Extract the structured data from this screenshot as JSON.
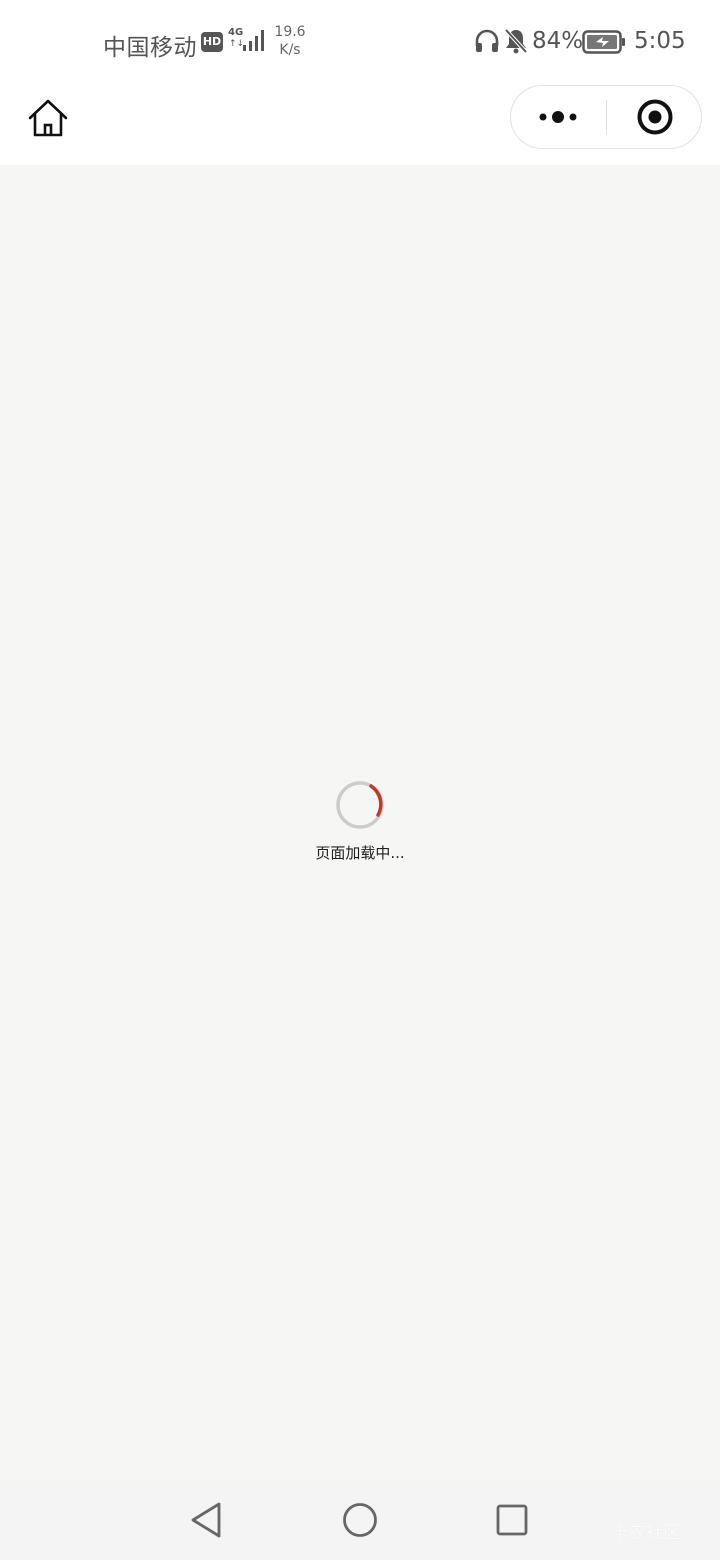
{
  "status_bar": {
    "carrier": "中国移动",
    "hd_badge": "HD",
    "network_type": "4G",
    "network_arrows": "↑↓",
    "net_speed_value": "19.6",
    "net_speed_unit": "K/s",
    "battery_percent": "84%",
    "time": "5:05",
    "icons": [
      "signal-icon",
      "headphones-icon",
      "bell-off-icon",
      "battery-charging-icon"
    ]
  },
  "nav_bar": {
    "icons": [
      "home-icon",
      "more-dots-icon",
      "close-target-icon"
    ]
  },
  "loading": {
    "text": "页面加载中...",
    "accent_color": "#c0392b",
    "track_color": "#cccccc"
  },
  "system_nav": {
    "icons": [
      "back-triangle-icon",
      "home-circle-icon",
      "recent-square-icon"
    ],
    "watermark": "卡农社区"
  },
  "colors": {
    "page_background": "#f6f6f4",
    "bar_background": "#ffffff",
    "status_text": "#555555"
  }
}
